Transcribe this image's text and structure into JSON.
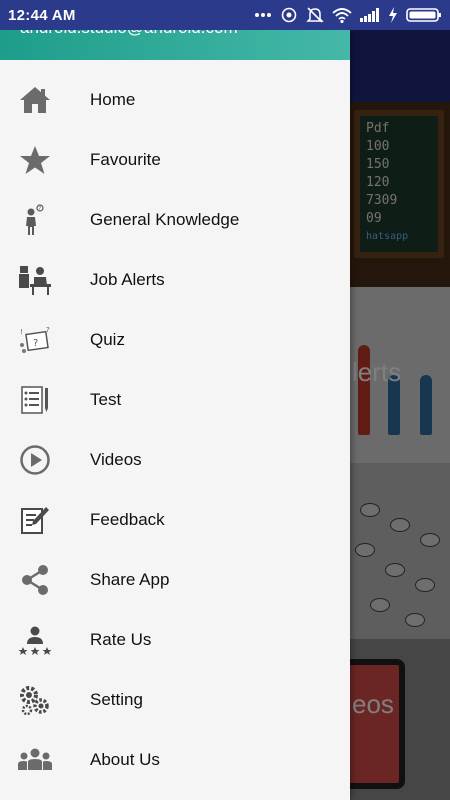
{
  "status_bar": {
    "time": "12:44 AM",
    "icons": [
      "more-dots-icon",
      "hotspot-icon",
      "mute-icon",
      "wifi-icon",
      "signal-icon",
      "charging-icon",
      "battery-icon"
    ]
  },
  "drawer": {
    "header_email": "android.studio@android.com",
    "header_colors": [
      "#1e9d8b",
      "#45b8a8"
    ],
    "items": [
      {
        "label": "Home",
        "icon": "home-icon"
      },
      {
        "label": "Favourite",
        "icon": "star-icon"
      },
      {
        "label": "General Knowledge",
        "icon": "thinking-person-icon"
      },
      {
        "label": "Job Alerts",
        "icon": "worker-desk-icon"
      },
      {
        "label": "Quiz",
        "icon": "quiz-icon"
      },
      {
        "label": "Test",
        "icon": "test-sheet-icon"
      },
      {
        "label": "Videos",
        "icon": "play-circle-icon"
      },
      {
        "label": "Feedback",
        "icon": "feedback-icon"
      },
      {
        "label": "Share App",
        "icon": "share-icon"
      },
      {
        "label": "Rate Us",
        "icon": "rate-icon"
      },
      {
        "label": "Setting",
        "icon": "gears-icon"
      },
      {
        "label": "About Us",
        "icon": "group-icon"
      }
    ]
  },
  "background": {
    "board_lines": [
      "Pdf",
      "100",
      "150",
      "120",
      "7309",
      "09"
    ],
    "board_tag": "hatsapp",
    "card2_text": "lerts",
    "card4_text": "eos"
  }
}
